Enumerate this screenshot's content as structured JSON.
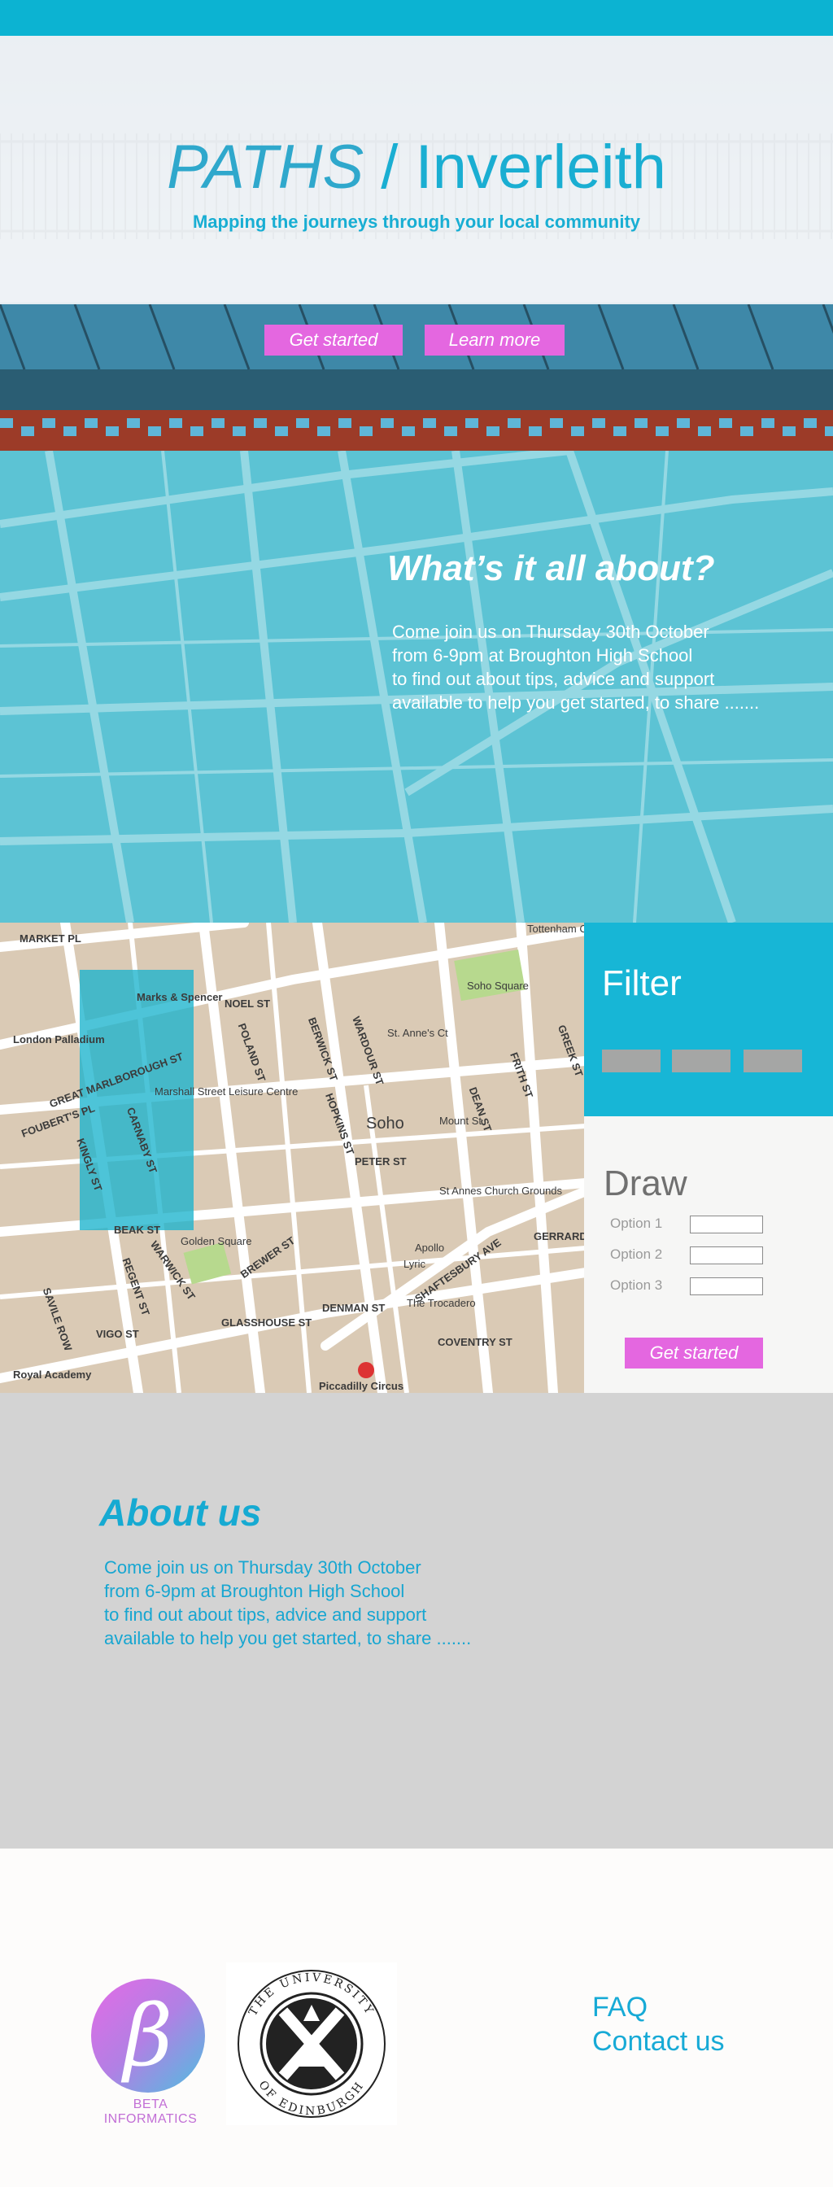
{
  "hero": {
    "title_italic": "PATHS",
    "title_rest": " / Inverleith",
    "subtitle": "Mapping the journeys through your local community",
    "primary_button": "Get started",
    "secondary_button": "Learn more"
  },
  "whats": {
    "title": "What’s it all about?",
    "lines": [
      "Come join us on Thursday 30th October",
      "from 6-9pm at Broughton High School",
      "to find out about tips, advice and support",
      "available to help you get started, to share ......."
    ]
  },
  "map": {
    "labels": [
      "MARKET PL",
      "Marks & Spencer",
      "NOEL ST",
      "London Palladium",
      "GREAT MARLBOROUGH ST",
      "Marshall Street Leisure Centre",
      "POLAND ST",
      "BERWICK ST",
      "WARDOUR ST",
      "Soho Square",
      "Soho",
      "HOPKINS ST",
      "PETER ST",
      "St Annes Church Grounds",
      "CARNABY ST",
      "KINGLY ST",
      "BEAK ST",
      "Golden Square",
      "BREWER ST",
      "SHAFTESBURY AVE",
      "Lyric",
      "Apollo",
      "The Trocadero",
      "DENMAN ST",
      "GLASSHOUSE ST",
      "REGENT ST",
      "WARWICK ST",
      "VIGO ST",
      "COVENTRY ST",
      "Piccadilly Circus",
      "Royal Academy",
      "SAVILE ROW",
      "Tottenham Court Road",
      "FRITH ST",
      "DEAN ST",
      "GREEK ST",
      "GERRARD ST",
      "FOUBERT'S PL",
      "Mount St",
      "St. Anne's Ct"
    ]
  },
  "filter": {
    "title": "Filter",
    "chips": [
      "",
      "",
      ""
    ]
  },
  "draw": {
    "title": "Draw",
    "options": [
      "Option 1",
      "Option 2",
      "Option 3"
    ],
    "button": "Get started"
  },
  "about": {
    "title": "About us",
    "lines": [
      "Come join us on Thursday 30th October",
      "from 6-9pm at Broughton High School",
      "to find out about tips, advice and support",
      "available to help you get started, to share ......."
    ]
  },
  "footer": {
    "beta_symbol": "β",
    "beta_text": "BETA INFORMATICS",
    "uoe_text": "THE UNIVERSITY OF EDINBURGH",
    "links": [
      "FAQ",
      "Contact us"
    ]
  },
  "colors": {
    "brand_teal": "#0cb3d2",
    "accent_pink": "#e467e0",
    "about_bg": "#d3d3d3"
  }
}
